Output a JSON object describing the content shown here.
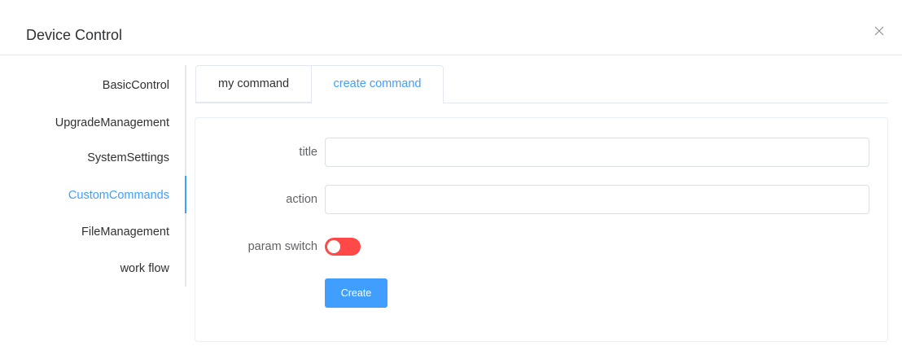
{
  "dialog": {
    "title": "Device Control",
    "close_icon": "close-icon"
  },
  "sidebar": {
    "items": [
      {
        "label": "BasicControl",
        "active": false
      },
      {
        "label": "UpgradeManagement",
        "active": false
      },
      {
        "label": "SystemSettings",
        "active": false
      },
      {
        "label": "CustomCommands",
        "active": true
      },
      {
        "label": "FileManagement",
        "active": false
      },
      {
        "label": "work flow",
        "active": false
      }
    ]
  },
  "tabs": [
    {
      "label": "my command",
      "active": false
    },
    {
      "label": "create command",
      "active": true
    }
  ],
  "form": {
    "title_label": "title",
    "title_value": "",
    "action_label": "action",
    "action_value": "",
    "param_switch_label": "param switch",
    "param_switch_on": false,
    "create_label": "Create"
  },
  "colors": {
    "accent": "#409eff",
    "switch_off": "#ff4949",
    "border": "#e4e7ed",
    "text": "#303133"
  }
}
